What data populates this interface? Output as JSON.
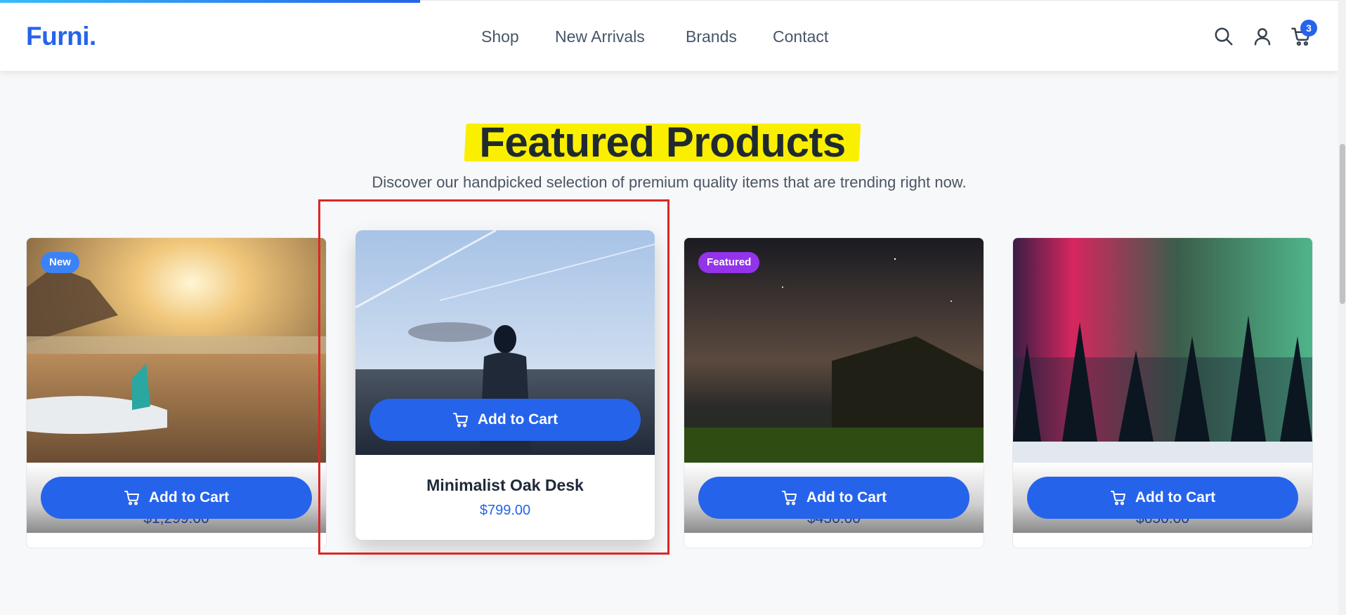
{
  "header": {
    "logo": "Furni.",
    "nav": [
      "Shop",
      "New Arrivals",
      "Brands",
      "Contact"
    ],
    "cart_count": "3",
    "icons": [
      "search-icon",
      "user-icon",
      "cart-icon"
    ]
  },
  "section": {
    "title": "Featured Products",
    "subtitle": "Discover our handpicked selection of premium quality items that are trending right now."
  },
  "products": [
    {
      "badge": "New",
      "name": "",
      "price": "$1,299.00",
      "button": "Add to Cart",
      "badge_color": "#3b82f6"
    },
    {
      "badge": "",
      "name": "Minimalist Oak Desk",
      "price": "$799.00",
      "button": "Add to Cart"
    },
    {
      "badge": "Featured",
      "name": "",
      "price": "$450.00",
      "button": "Add to Cart",
      "badge_color": "#9333ea"
    },
    {
      "badge": "",
      "name": "",
      "price": "$650.00",
      "button": "Add to Cart"
    }
  ],
  "colors": {
    "accent": "#2563eb",
    "highlight": "#fbef00",
    "selection_box": "#dc2626"
  }
}
